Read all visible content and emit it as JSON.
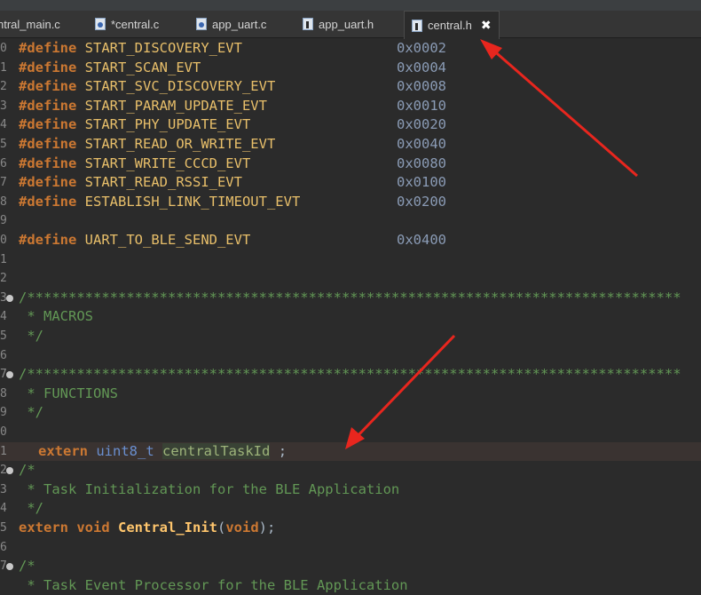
{
  "tabs": [
    {
      "label": "ntral_main.c",
      "icon": "c-file-icon",
      "active": false
    },
    {
      "label": "*central.c",
      "icon": "c-file-icon",
      "active": false
    },
    {
      "label": "app_uart.c",
      "icon": "c-file-icon",
      "active": false
    },
    {
      "label": "app_uart.h",
      "icon": "h-file-icon",
      "active": false
    },
    {
      "label": "central.h",
      "icon": "h-file-icon",
      "active": true
    }
  ],
  "close_glyph": "✖",
  "gutter": [
    "0",
    "1",
    "2",
    "3",
    "4",
    "5",
    "6",
    "7",
    "8",
    "9",
    "0",
    "1",
    "2",
    "3",
    "4",
    "5",
    "6",
    "7",
    "8",
    "9",
    "0",
    "1",
    "2",
    "3",
    "4",
    "5",
    "6",
    "7"
  ],
  "defines": [
    {
      "kw": "#define",
      "name": "START_DISCOVERY_EVT",
      "value": "0x0002"
    },
    {
      "kw": "#define",
      "name": "START_SCAN_EVT",
      "value": "0x0004"
    },
    {
      "kw": "#define",
      "name": "START_SVC_DISCOVERY_EVT",
      "value": "0x0008"
    },
    {
      "kw": "#define",
      "name": "START_PARAM_UPDATE_EVT",
      "value": "0x0010"
    },
    {
      "kw": "#define",
      "name": "START_PHY_UPDATE_EVT",
      "value": "0x0020"
    },
    {
      "kw": "#define",
      "name": "START_READ_OR_WRITE_EVT",
      "value": "0x0040"
    },
    {
      "kw": "#define",
      "name": "START_WRITE_CCCD_EVT",
      "value": "0x0080"
    },
    {
      "kw": "#define",
      "name": "START_READ_RSSI_EVT",
      "value": "0x0100"
    },
    {
      "kw": "#define",
      "name": "ESTABLISH_LINK_TIMEOUT_EVT",
      "value": "0x0200"
    },
    {
      "kw": "#define",
      "name": "UART_TO_BLE_SEND_EVT",
      "value": "0x0400"
    }
  ],
  "comments": {
    "stars": "/*******************************************************************************",
    "macros": " * MACROS",
    "functions": " * FUNCTIONS",
    "close": " */",
    "open": "/*",
    "task_init": " * Task Initialization for the BLE Application",
    "task_event": " * Task Event Processor for the BLE Application"
  },
  "extern_line": {
    "kw": "extern",
    "type": "uint8_t",
    "var": "centralTaskId",
    "end": ";"
  },
  "init_line": {
    "kw": "extern",
    "kw2": "void",
    "fn": "Central_Init",
    "lp": "(",
    "param": "void",
    "rp": ");"
  }
}
